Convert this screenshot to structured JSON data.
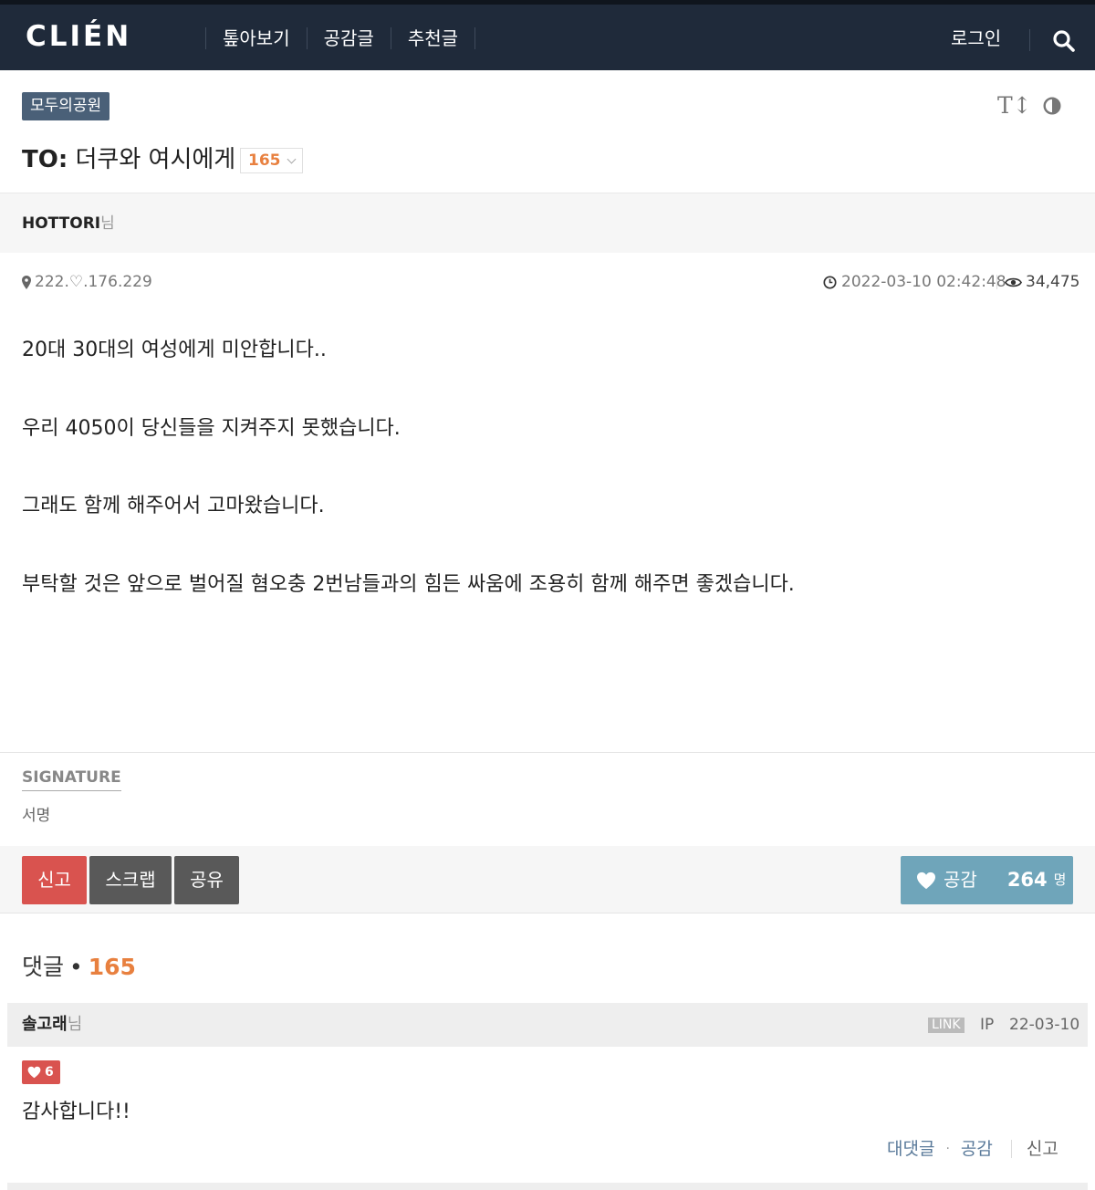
{
  "header": {
    "logo": "CLIÉN",
    "nav": [
      "톺아보기",
      "공감글",
      "추천글"
    ],
    "login": "로그인",
    "search_icon": "search-icon"
  },
  "post": {
    "board": "모두의공원",
    "title_prefix": "TO:",
    "title_text": " 더쿠와 여시에게",
    "comment_count": "165",
    "author": "HOTTORI",
    "author_suffix": "님",
    "ip": "222.♡.176.229",
    "datetime": "2022-03-10 02:42:48",
    "views": "34,475",
    "body": [
      "20대 30대의 여성에게 미안합니다..",
      "우리 4050이 당신들을 지켜주지 못했습니다.",
      "그래도 함께 해주어서 고마왔습니다.",
      "부탁할 것은 앞으로 벌어질 혐오충 2번남들과의 힘든 싸움에 조용히 함께 해주면 좋겠습니다."
    ],
    "signature_label": "SIGNATURE",
    "signature_text": "서명"
  },
  "actions": {
    "report": "신고",
    "scrap": "스크랩",
    "share": "공유",
    "like_label": "공감",
    "like_count": "264",
    "like_unit": "명"
  },
  "comments": {
    "heading": "댓글",
    "dot": "•",
    "count": "165",
    "items": [
      {
        "author": "솔고래",
        "author_suffix": "님",
        "link_badge": "LINK",
        "ip": "IP",
        "date": "22-03-10",
        "likes": "6",
        "text": "감사합니다!!",
        "reply": "대댓글",
        "sep": "·",
        "like": "공감",
        "report": "신고"
      }
    ]
  },
  "colors": {
    "header_bg": "#1f2a3a",
    "badge_bg": "#4a6078",
    "accent_orange": "#e8803f",
    "report_red": "#d9534f",
    "like_blue": "#6fa5ba",
    "dark_button": "#595959"
  }
}
